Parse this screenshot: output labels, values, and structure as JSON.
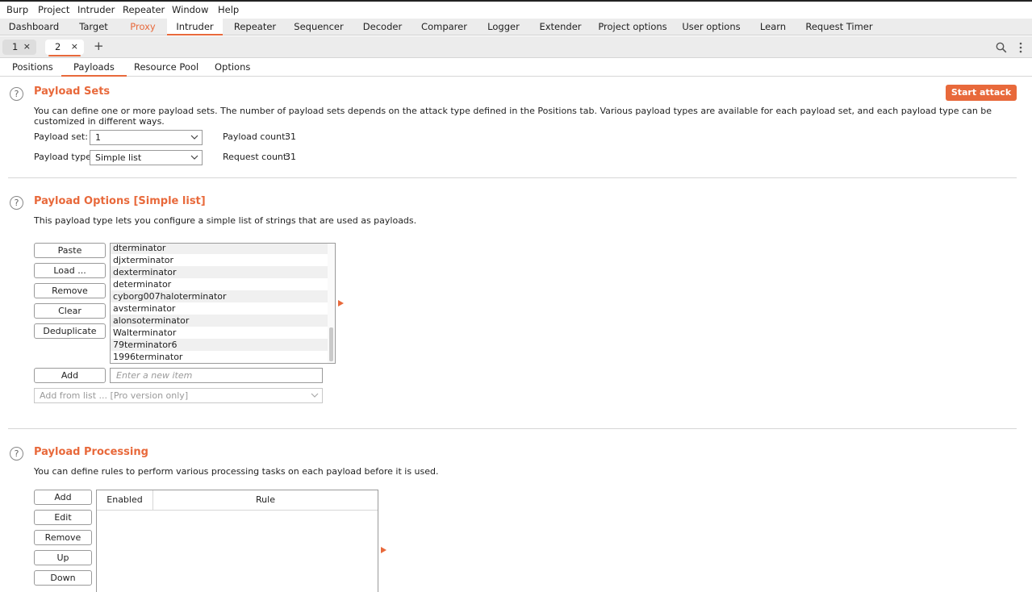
{
  "menu": [
    "Burp",
    "Project",
    "Intruder",
    "Repeater",
    "Window",
    "Help"
  ],
  "main_tabs": [
    "Dashboard",
    "Target",
    "Proxy",
    "Intruder",
    "Repeater",
    "Sequencer",
    "Decoder",
    "Comparer",
    "Logger",
    "Extender",
    "Project options",
    "User options",
    "Learn",
    "Request Timer"
  ],
  "sub_tabs": [
    {
      "label": "1"
    },
    {
      "label": "2"
    }
  ],
  "sub_tab_close": "×",
  "add_tab": "+",
  "section_tabs": [
    "Positions",
    "Payloads",
    "Resource Pool",
    "Options"
  ],
  "payload_sets": {
    "title": "Payload Sets",
    "description": "You can define one or more payload sets. The number of payload sets depends on the attack type defined in the Positions tab. Various payload types are available for each payload set, and each payload type can be customized in different ways.",
    "set_label": "Payload set:",
    "set_value": "1",
    "type_label": "Payload type:",
    "type_value": "Simple list",
    "count_label": "Payload count:",
    "count_value": "31",
    "request_label": "Request count:",
    "request_value": "31",
    "start_attack": "Start attack"
  },
  "payload_options": {
    "title": "Payload Options [Simple list]",
    "description": "This payload type lets you configure a simple list of strings that are used as payloads.",
    "buttons": [
      "Paste",
      "Load ...",
      "Remove",
      "Clear",
      "Deduplicate"
    ],
    "items": [
      "dterminator",
      "djxterminator",
      "dexterminator",
      "determinator",
      "cyborg007haloterminator",
      "avsterminator",
      "alonsoterminator",
      "Walterminator",
      "79terminator6",
      "1996terminator"
    ],
    "add_label": "Add",
    "new_item_placeholder": "Enter a new item",
    "add_from_list": "Add from list ... [Pro version only]"
  },
  "payload_processing": {
    "title": "Payload Processing",
    "description": "You can define rules to perform various processing tasks on each payload before it is used.",
    "buttons": [
      "Add",
      "Edit",
      "Remove",
      "Up",
      "Down"
    ],
    "columns": [
      "Enabled",
      "Rule"
    ]
  },
  "colors": {
    "accent": "#e8693b"
  },
  "icons": [
    "search-icon",
    "more-icon",
    "help-icon",
    "close-icon",
    "chevron-down-icon",
    "arrow-right-icon"
  ]
}
